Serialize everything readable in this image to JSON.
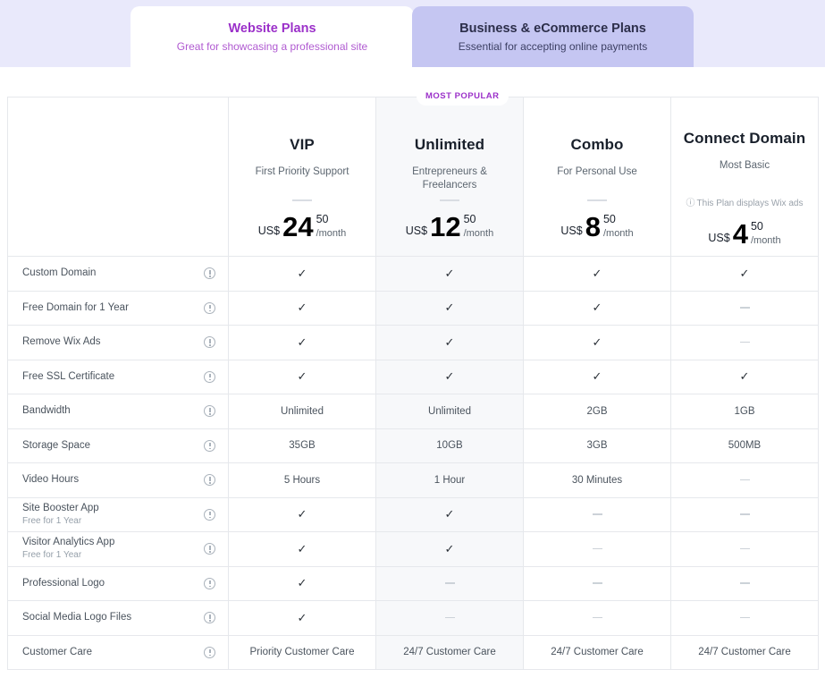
{
  "tabs": [
    {
      "id": "website-plans",
      "title": "Website Plans",
      "subtitle": "Great for showcasing a professional site",
      "active": true
    },
    {
      "id": "business-ecommerce-plans",
      "title": "Business & eCommerce Plans",
      "subtitle": "Essential for accepting online payments",
      "active": false
    }
  ],
  "badge": {
    "label": "MOST POPULAR"
  },
  "plans": [
    {
      "name": "VIP",
      "tagline": "First Priority Support",
      "note": null,
      "currency": "US$",
      "amount": "24",
      "cents": "50",
      "period": "/month",
      "highlight": false
    },
    {
      "name": "Unlimited",
      "tagline": "Entrepreneurs & Freelancers",
      "note": null,
      "currency": "US$",
      "amount": "12",
      "cents": "50",
      "period": "/month",
      "highlight": true
    },
    {
      "name": "Combo",
      "tagline": "For Personal Use",
      "note": null,
      "currency": "US$",
      "amount": "8",
      "cents": "50",
      "period": "/month",
      "highlight": false
    },
    {
      "name": "Connect Domain",
      "tagline": "Most Basic",
      "note": "This Plan displays Wix ads",
      "currency": "US$",
      "amount": "4",
      "cents": "50",
      "period": "/month",
      "highlight": false
    }
  ],
  "features": [
    {
      "label": "Custom Domain",
      "sub": null,
      "values": [
        "check",
        "check",
        "check",
        "check"
      ]
    },
    {
      "label": "Free Domain for 1 Year",
      "sub": null,
      "values": [
        "check",
        "check",
        "check",
        "dash"
      ]
    },
    {
      "label": "Remove Wix Ads",
      "sub": null,
      "values": [
        "check",
        "check",
        "check",
        "dash"
      ]
    },
    {
      "label": "Free SSL Certificate",
      "sub": null,
      "values": [
        "check",
        "check",
        "check",
        "check"
      ]
    },
    {
      "label": "Bandwidth",
      "sub": null,
      "values": [
        "Unlimited",
        "Unlimited",
        "2GB",
        "1GB"
      ]
    },
    {
      "label": "Storage Space",
      "sub": null,
      "values": [
        "35GB",
        "10GB",
        "3GB",
        "500MB"
      ]
    },
    {
      "label": "Video Hours",
      "sub": null,
      "values": [
        "5 Hours",
        "1 Hour",
        "30 Minutes",
        "dash"
      ]
    },
    {
      "label": "Site Booster App",
      "sub": "Free for 1 Year",
      "values": [
        "check",
        "check",
        "dash",
        "dash"
      ]
    },
    {
      "label": "Visitor Analytics App",
      "sub": "Free for 1 Year",
      "values": [
        "check",
        "check",
        "dash",
        "dash"
      ]
    },
    {
      "label": "Professional Logo",
      "sub": null,
      "values": [
        "check",
        "dash",
        "dash",
        "dash"
      ]
    },
    {
      "label": "Social Media Logo Files",
      "sub": null,
      "values": [
        "check",
        "dash",
        "dash",
        "dash"
      ]
    },
    {
      "label": "Customer Care",
      "sub": null,
      "values": [
        "Priority Customer Care",
        "24/7 Customer Care",
        "24/7 Customer Care",
        "24/7 Customer Care"
      ]
    }
  ],
  "icons": {
    "info": "info-icon",
    "check": "✓"
  },
  "colors": {
    "tab_bar_bg": "#e9e9fb",
    "tab_active_bg": "#ffffff",
    "tab_inactive_bg": "#c5c6f2",
    "accent_purple": "#9b30c9",
    "highlight_column": "#f7f8fa",
    "border": "#e6e8ec"
  }
}
